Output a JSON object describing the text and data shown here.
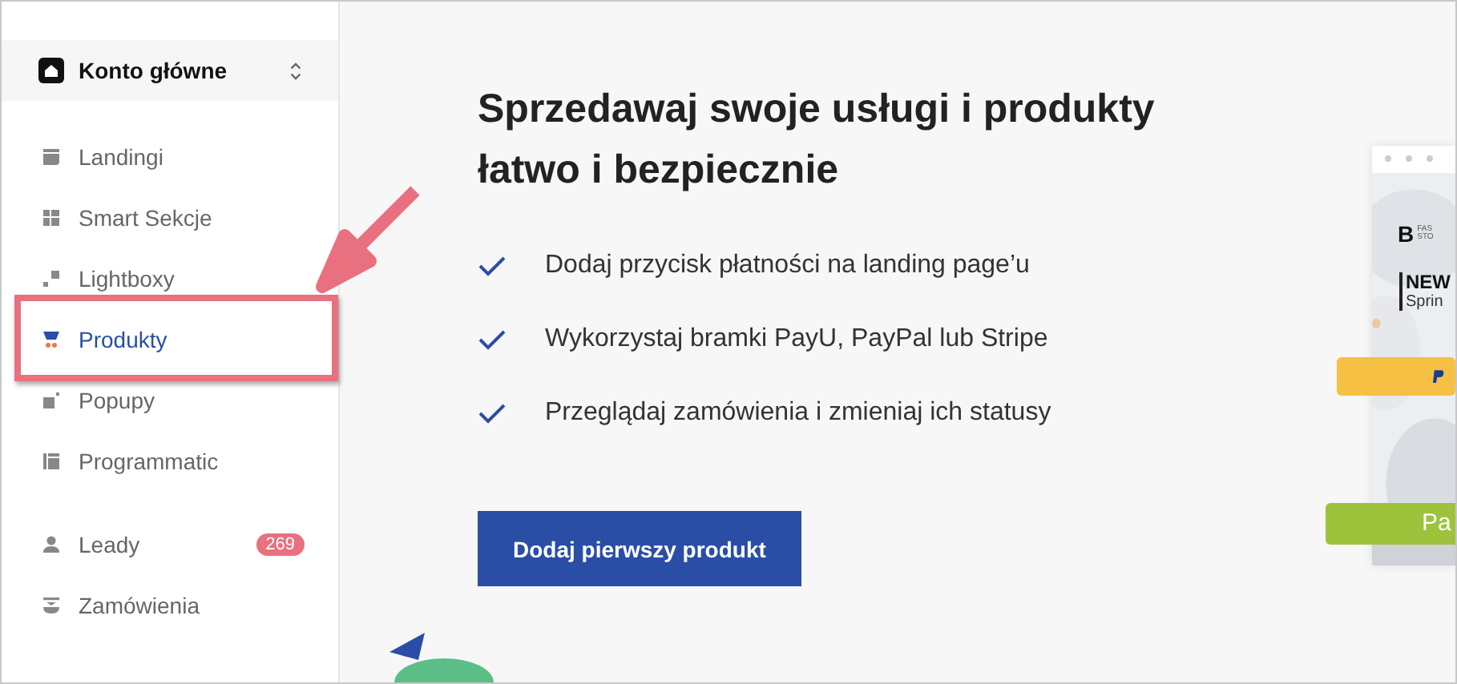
{
  "account": {
    "name": "Konto główne"
  },
  "sidebar": {
    "items": [
      {
        "label": "Landingi",
        "kind": "landing",
        "selected": false
      },
      {
        "label": "Smart Sekcje",
        "kind": "grid",
        "selected": false
      },
      {
        "label": "Lightboxy",
        "kind": "lightbox",
        "selected": false
      },
      {
        "label": "Produkty",
        "kind": "product",
        "selected": true
      },
      {
        "label": "Popupy",
        "kind": "popup",
        "selected": false
      },
      {
        "label": "Programmatic",
        "kind": "program",
        "selected": false
      }
    ],
    "bottom_items": [
      {
        "label": "Leady",
        "kind": "user",
        "badge": "269",
        "selected": false
      },
      {
        "label": "Zamówienia",
        "kind": "order",
        "selected": false
      }
    ]
  },
  "main": {
    "title": "Sprzedawaj swoje usługi i produkty łatwo i bezpiecznie",
    "features": [
      "Dodaj przycisk płatności na landing page’u",
      "Wykorzystaj bramki PayU, PayPal lub Stripe",
      "Przeglądaj zamówienia i zmieniaj ich statusy"
    ],
    "button": "Dodaj pierwszy produkt"
  },
  "preview": {
    "logo": "B",
    "logo_text_1": "FAS",
    "logo_text_2": "STO",
    "headline": "NEW",
    "subline": "Sprin",
    "green_button": "Pa"
  }
}
